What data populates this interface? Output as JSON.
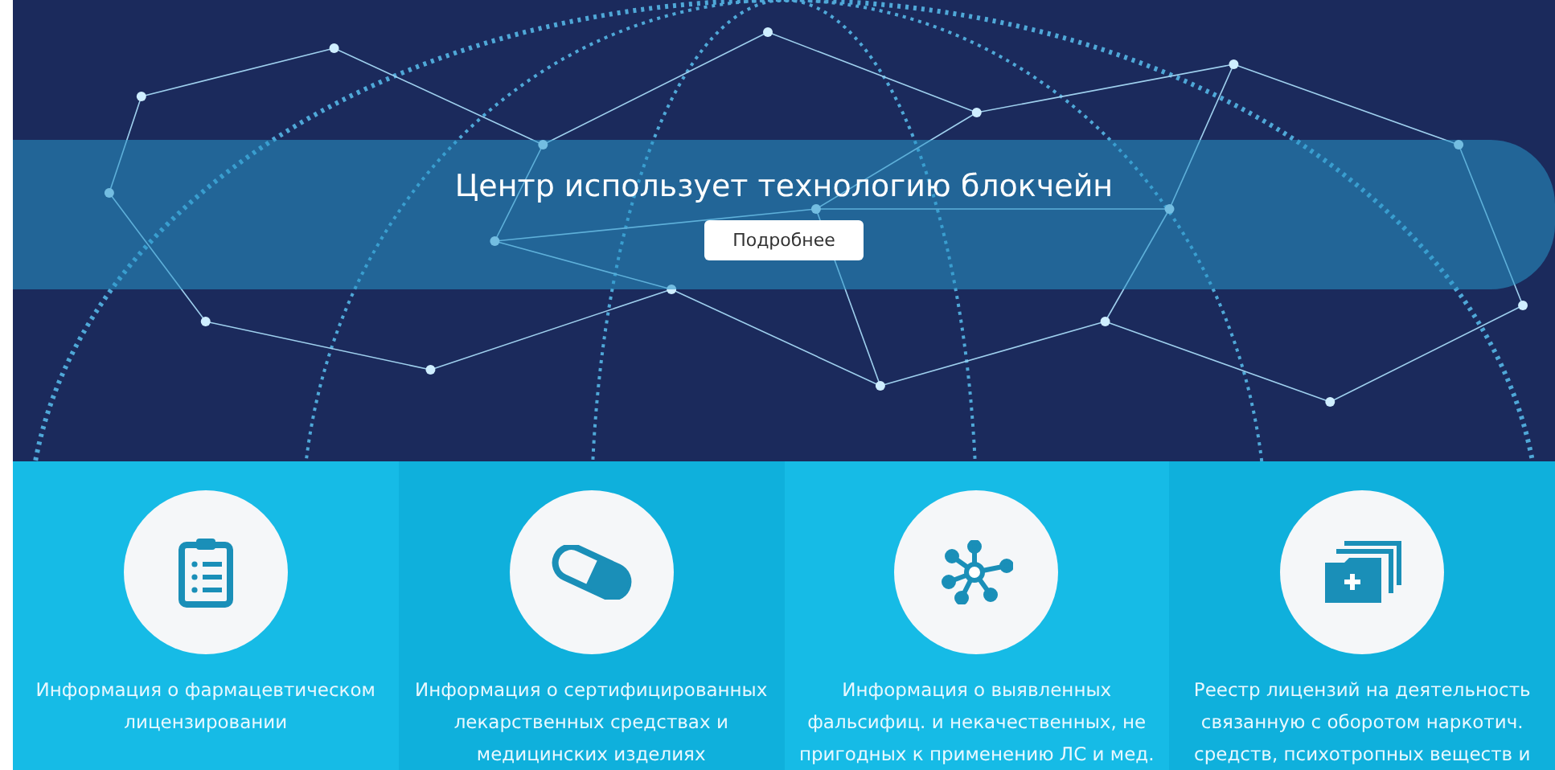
{
  "hero": {
    "title": "Центр использует технологию блокчейн",
    "button": "Подробнее"
  },
  "cards": [
    {
      "kind": "clipboard",
      "text": "Информация о фармацевтическом\nлицензировании"
    },
    {
      "kind": "pill",
      "text": "Информация о сертифицированных\nлекарственных средствах и\nмедицинских изделиях"
    },
    {
      "kind": "network",
      "text": "Информация о выявленных\nфальсифиц. и некачественных, не\nпригодных к применению ЛС и мед."
    },
    {
      "kind": "folders",
      "text": "Реестр лицензий на деятельность\nсвязанную с оборотом наркотич.\nсредств, психотропных веществ и"
    }
  ]
}
